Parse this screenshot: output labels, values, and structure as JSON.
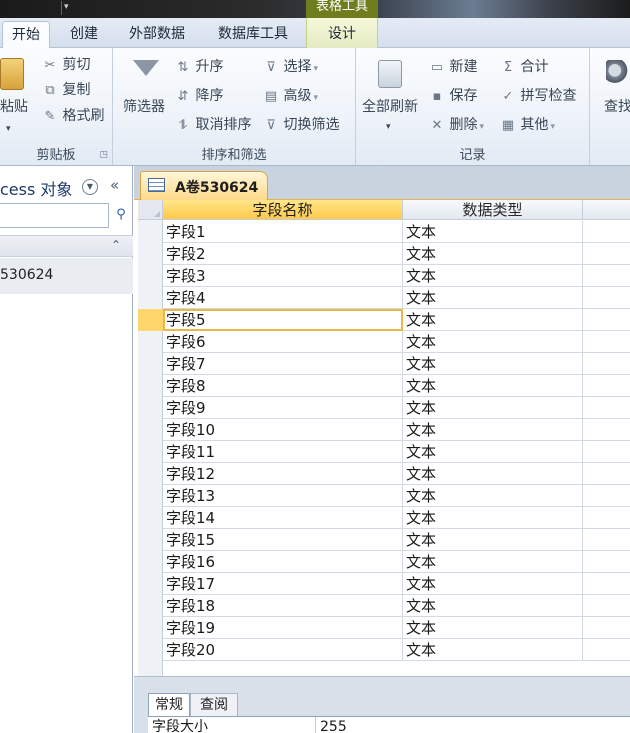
{
  "ribbon_tabs": {
    "home": "开始",
    "create": "创建",
    "external_data": "外部数据",
    "database_tools": "数据库工具",
    "design": "设计",
    "context_title": "表格工具"
  },
  "clipboard": {
    "paste": "粘贴",
    "cut": "剪切",
    "copy": "复制",
    "format_painter": "格式刷",
    "group_label": "剪贴板"
  },
  "sort_filter": {
    "filter": "筛选器",
    "ascending": "升序",
    "descending": "降序",
    "remove_sort": "取消排序",
    "selection": "选择",
    "advanced": "高级",
    "toggle_filter": "切换筛选",
    "group_label": "排序和筛选"
  },
  "records": {
    "refresh_all": "全部刷新",
    "new": "新建",
    "save": "保存",
    "delete": "删除",
    "totals": "合计",
    "spelling": "拼写检查",
    "more": "其他",
    "group_label": "记录"
  },
  "find": {
    "label": "查找"
  },
  "nav": {
    "title": "cess 对象",
    "item": "530624"
  },
  "document": {
    "tab_label": "A卷530624"
  },
  "grid": {
    "headers": [
      "字段名称",
      "数据类型"
    ],
    "rows": [
      [
        "字段1",
        "文本"
      ],
      [
        "字段2",
        "文本"
      ],
      [
        "字段3",
        "文本"
      ],
      [
        "字段4",
        "文本"
      ],
      [
        "字段5",
        "文本"
      ],
      [
        "字段6",
        "文本"
      ],
      [
        "字段7",
        "文本"
      ],
      [
        "字段8",
        "文本"
      ],
      [
        "字段9",
        "文本"
      ],
      [
        "字段10",
        "文本"
      ],
      [
        "字段11",
        "文本"
      ],
      [
        "字段12",
        "文本"
      ],
      [
        "字段13",
        "文本"
      ],
      [
        "字段14",
        "文本"
      ],
      [
        "字段15",
        "文本"
      ],
      [
        "字段16",
        "文本"
      ],
      [
        "字段17",
        "文本"
      ],
      [
        "字段18",
        "文本"
      ],
      [
        "字段19",
        "文本"
      ],
      [
        "字段20",
        "文本"
      ]
    ],
    "current_row": 4
  },
  "properties": {
    "tab_general": "常规",
    "tab_lookup": "查阅",
    "field_size_label": "字段大小",
    "field_size_value": "255"
  },
  "colors": {
    "accent": "#ffc94a",
    "context_tab": "#6f7d1f",
    "nav_title": "#1f3a6a"
  }
}
